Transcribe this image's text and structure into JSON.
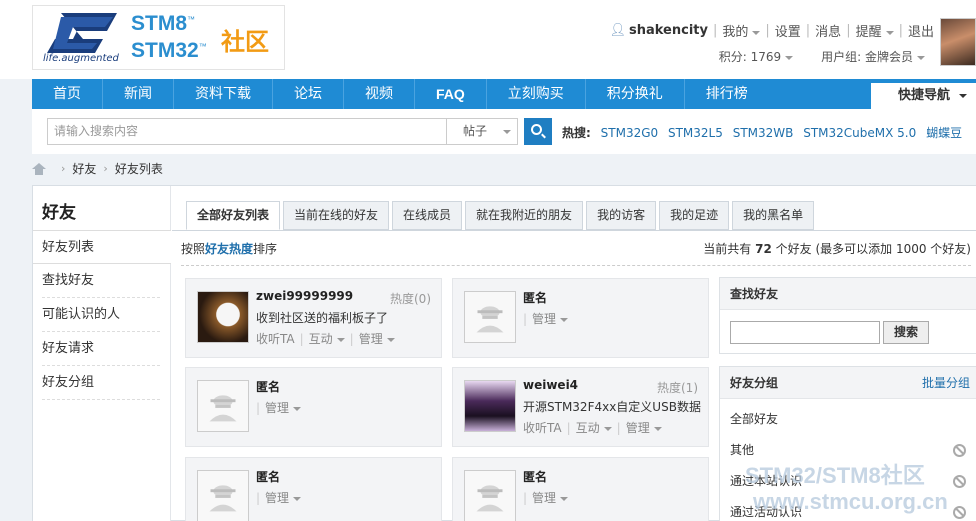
{
  "logo": {
    "stm8": "STM8",
    "stm32": "STM32",
    "tm": "™",
    "community": "社区",
    "tagline": "life.augmented"
  },
  "user": {
    "name": "shakencity",
    "menu_mine": "我的",
    "settings": "设置",
    "messages": "消息",
    "reminders": "提醒",
    "logout": "退出",
    "points": "积分: 1769",
    "group": "用户组: 金牌会员"
  },
  "nav": {
    "items": [
      "首页",
      "新闻",
      "资料下载",
      "论坛",
      "视频",
      "FAQ",
      "立刻购买",
      "积分换礼",
      "排行榜"
    ],
    "quick": "快捷导航"
  },
  "search": {
    "placeholder": "请输入搜索内容",
    "type": "帖子",
    "hot_label": "热搜:",
    "hot": [
      "STM32G0",
      "STM32L5",
      "STM32WB",
      "STM32CubeMX 5.0",
      "蝴蝶豆"
    ]
  },
  "breadcrumb": [
    "好友",
    "好友列表"
  ],
  "sidebar": {
    "title": "好友",
    "items": [
      "好友列表",
      "查找好友",
      "可能认识的人",
      "好友请求",
      "好友分组"
    ]
  },
  "tabs": [
    "全部好友列表",
    "当前在线的好友",
    "在线成员",
    "就在我附近的朋友",
    "我的访客",
    "我的足迹",
    "我的黑名单"
  ],
  "sort": {
    "prefix": "按照",
    "key": "好友热度",
    "suffix": "排序"
  },
  "count": {
    "prefix": "当前共有 ",
    "num": "72",
    "suffix": " 个好友 (最多可以添加 1000 个好友)"
  },
  "friends": [
    {
      "name": "zwei99999999",
      "hot": "热度(0)",
      "msg": "收到社区送的福利板子了",
      "follow": "收听TA",
      "interact": "互动",
      "manage": "管理"
    },
    {
      "name": "匿名",
      "manage": "管理"
    },
    {
      "name": "匿名",
      "manage": "管理"
    },
    {
      "name": "weiwei4",
      "hot": "热度(1)",
      "msg": "开源STM32F4xx自定义USB数据",
      "follow": "收听TA",
      "interact": "互动",
      "manage": "管理"
    },
    {
      "name": "匿名",
      "manage": "管理"
    },
    {
      "name": "匿名",
      "manage": "管理"
    }
  ],
  "find_panel": {
    "title": "查找好友",
    "button": "搜索"
  },
  "group_panel": {
    "title": "好友分组",
    "batch": "批量分组",
    "groups": [
      "全部好友",
      "其他",
      "通过本站认识",
      "通过活动认识"
    ]
  },
  "watermark": {
    "line1": "STM32/STM8社区",
    "line2": "www.stmcu.org.cn"
  },
  "colors": {
    "nav": "#1f8bd4",
    "link": "#1f6fab",
    "accent": "#f29b14"
  }
}
